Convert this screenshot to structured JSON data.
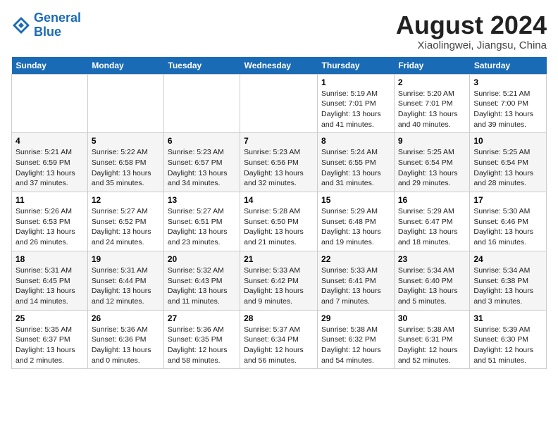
{
  "header": {
    "logo_line1": "General",
    "logo_line2": "Blue",
    "month_year": "August 2024",
    "location": "Xiaolingwei, Jiangsu, China"
  },
  "weekdays": [
    "Sunday",
    "Monday",
    "Tuesday",
    "Wednesday",
    "Thursday",
    "Friday",
    "Saturday"
  ],
  "weeks": [
    [
      {
        "day": "",
        "info": ""
      },
      {
        "day": "",
        "info": ""
      },
      {
        "day": "",
        "info": ""
      },
      {
        "day": "",
        "info": ""
      },
      {
        "day": "1",
        "info": "Sunrise: 5:19 AM\nSunset: 7:01 PM\nDaylight: 13 hours\nand 41 minutes."
      },
      {
        "day": "2",
        "info": "Sunrise: 5:20 AM\nSunset: 7:01 PM\nDaylight: 13 hours\nand 40 minutes."
      },
      {
        "day": "3",
        "info": "Sunrise: 5:21 AM\nSunset: 7:00 PM\nDaylight: 13 hours\nand 39 minutes."
      }
    ],
    [
      {
        "day": "4",
        "info": "Sunrise: 5:21 AM\nSunset: 6:59 PM\nDaylight: 13 hours\nand 37 minutes."
      },
      {
        "day": "5",
        "info": "Sunrise: 5:22 AM\nSunset: 6:58 PM\nDaylight: 13 hours\nand 35 minutes."
      },
      {
        "day": "6",
        "info": "Sunrise: 5:23 AM\nSunset: 6:57 PM\nDaylight: 13 hours\nand 34 minutes."
      },
      {
        "day": "7",
        "info": "Sunrise: 5:23 AM\nSunset: 6:56 PM\nDaylight: 13 hours\nand 32 minutes."
      },
      {
        "day": "8",
        "info": "Sunrise: 5:24 AM\nSunset: 6:55 PM\nDaylight: 13 hours\nand 31 minutes."
      },
      {
        "day": "9",
        "info": "Sunrise: 5:25 AM\nSunset: 6:54 PM\nDaylight: 13 hours\nand 29 minutes."
      },
      {
        "day": "10",
        "info": "Sunrise: 5:25 AM\nSunset: 6:54 PM\nDaylight: 13 hours\nand 28 minutes."
      }
    ],
    [
      {
        "day": "11",
        "info": "Sunrise: 5:26 AM\nSunset: 6:53 PM\nDaylight: 13 hours\nand 26 minutes."
      },
      {
        "day": "12",
        "info": "Sunrise: 5:27 AM\nSunset: 6:52 PM\nDaylight: 13 hours\nand 24 minutes."
      },
      {
        "day": "13",
        "info": "Sunrise: 5:27 AM\nSunset: 6:51 PM\nDaylight: 13 hours\nand 23 minutes."
      },
      {
        "day": "14",
        "info": "Sunrise: 5:28 AM\nSunset: 6:50 PM\nDaylight: 13 hours\nand 21 minutes."
      },
      {
        "day": "15",
        "info": "Sunrise: 5:29 AM\nSunset: 6:48 PM\nDaylight: 13 hours\nand 19 minutes."
      },
      {
        "day": "16",
        "info": "Sunrise: 5:29 AM\nSunset: 6:47 PM\nDaylight: 13 hours\nand 18 minutes."
      },
      {
        "day": "17",
        "info": "Sunrise: 5:30 AM\nSunset: 6:46 PM\nDaylight: 13 hours\nand 16 minutes."
      }
    ],
    [
      {
        "day": "18",
        "info": "Sunrise: 5:31 AM\nSunset: 6:45 PM\nDaylight: 13 hours\nand 14 minutes."
      },
      {
        "day": "19",
        "info": "Sunrise: 5:31 AM\nSunset: 6:44 PM\nDaylight: 13 hours\nand 12 minutes."
      },
      {
        "day": "20",
        "info": "Sunrise: 5:32 AM\nSunset: 6:43 PM\nDaylight: 13 hours\nand 11 minutes."
      },
      {
        "day": "21",
        "info": "Sunrise: 5:33 AM\nSunset: 6:42 PM\nDaylight: 13 hours\nand 9 minutes."
      },
      {
        "day": "22",
        "info": "Sunrise: 5:33 AM\nSunset: 6:41 PM\nDaylight: 13 hours\nand 7 minutes."
      },
      {
        "day": "23",
        "info": "Sunrise: 5:34 AM\nSunset: 6:40 PM\nDaylight: 13 hours\nand 5 minutes."
      },
      {
        "day": "24",
        "info": "Sunrise: 5:34 AM\nSunset: 6:38 PM\nDaylight: 13 hours\nand 3 minutes."
      }
    ],
    [
      {
        "day": "25",
        "info": "Sunrise: 5:35 AM\nSunset: 6:37 PM\nDaylight: 13 hours\nand 2 minutes."
      },
      {
        "day": "26",
        "info": "Sunrise: 5:36 AM\nSunset: 6:36 PM\nDaylight: 13 hours\nand 0 minutes."
      },
      {
        "day": "27",
        "info": "Sunrise: 5:36 AM\nSunset: 6:35 PM\nDaylight: 12 hours\nand 58 minutes."
      },
      {
        "day": "28",
        "info": "Sunrise: 5:37 AM\nSunset: 6:34 PM\nDaylight: 12 hours\nand 56 minutes."
      },
      {
        "day": "29",
        "info": "Sunrise: 5:38 AM\nSunset: 6:32 PM\nDaylight: 12 hours\nand 54 minutes."
      },
      {
        "day": "30",
        "info": "Sunrise: 5:38 AM\nSunset: 6:31 PM\nDaylight: 12 hours\nand 52 minutes."
      },
      {
        "day": "31",
        "info": "Sunrise: 5:39 AM\nSunset: 6:30 PM\nDaylight: 12 hours\nand 51 minutes."
      }
    ]
  ]
}
